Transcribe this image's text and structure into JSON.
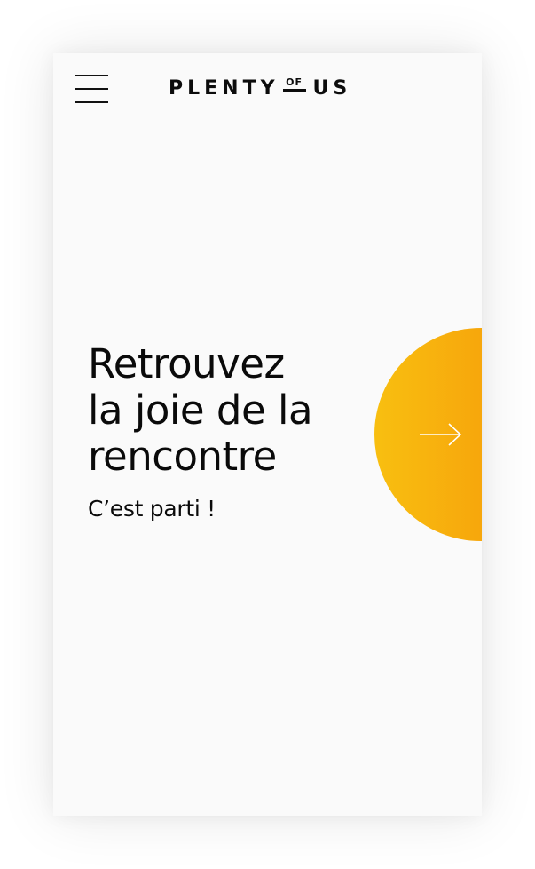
{
  "header": {
    "menu_icon": "hamburger-menu-icon",
    "logo": {
      "word1": "PLENTY",
      "of": "OF",
      "word2": "US"
    }
  },
  "hero": {
    "headline_lines": [
      "Retrouvez",
      "la joie de la",
      "rencontre"
    ],
    "subtitle": "C’est parti !",
    "cta_icon": "arrow-right-icon"
  },
  "colors": {
    "background": "#fafafa",
    "text": "#0a0a0a",
    "accent_start": "#f8bf10",
    "accent_end": "#f58c06"
  }
}
